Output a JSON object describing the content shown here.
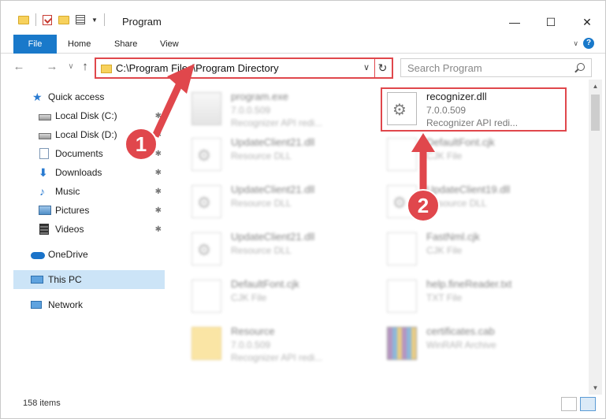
{
  "window": {
    "title": "Program",
    "controls": {
      "minimize": "—",
      "maximize": "☐",
      "close": "✕"
    }
  },
  "ribbon": {
    "tabs": [
      {
        "label": "File"
      },
      {
        "label": "Home"
      },
      {
        "label": "Share"
      },
      {
        "label": "View"
      }
    ],
    "help": "?",
    "expand": "∨"
  },
  "navigation": {
    "back": "←",
    "forward": "→",
    "recent": "∨",
    "up": "↑",
    "address": "C:\\Program Files\\Program Directory",
    "address_chevron": "∨",
    "refresh": "↻",
    "search_placeholder": "Search Program"
  },
  "sidebar": {
    "items": [
      {
        "label": "Quick access",
        "icon": "star-icon",
        "pinned": false
      },
      {
        "label": "Local Disk (C:)",
        "icon": "drive-icon",
        "pinned": true
      },
      {
        "label": "Local Disk (D:)",
        "icon": "drive-icon",
        "pinned": true
      },
      {
        "label": "Documents",
        "icon": "documents-icon",
        "pinned": true
      },
      {
        "label": "Downloads",
        "icon": "download-icon",
        "pinned": true
      },
      {
        "label": "Music",
        "icon": "music-icon",
        "pinned": true
      },
      {
        "label": "Pictures",
        "icon": "pictures-icon",
        "pinned": true
      },
      {
        "label": "Videos",
        "icon": "videos-icon",
        "pinned": true
      },
      {
        "label": "OneDrive",
        "icon": "cloud-icon",
        "pinned": false
      },
      {
        "label": "This PC",
        "icon": "computer-icon",
        "pinned": false,
        "selected": true
      },
      {
        "label": "Network",
        "icon": "network-icon",
        "pinned": false
      }
    ],
    "pin_glyph": "📌"
  },
  "files": [
    {
      "name": "program.exe",
      "meta1": "7.0.0.509",
      "meta2": "Recognizer API redi...",
      "icon": "exe-icon",
      "blurred": true
    },
    {
      "name": "recognizer.dll",
      "meta1": "7.0.0.509",
      "meta2": "Recognizer API redi...",
      "icon": "dll-icon",
      "blurred": false,
      "highlighted": true
    },
    {
      "name": "UpdateClient21.dll",
      "meta1": "Resource DLL",
      "meta2": "",
      "icon": "dll-icon",
      "blurred": true
    },
    {
      "name": "DefaultFont.cjk",
      "meta1": "CJK File",
      "meta2": "",
      "icon": "document-icon",
      "blurred": true
    },
    {
      "name": "UpdateClient21.dll",
      "meta1": "Resource DLL",
      "meta2": "",
      "icon": "dll-icon",
      "blurred": true
    },
    {
      "name": "UpdateClient19.dll",
      "meta1": "Resource DLL",
      "meta2": "",
      "icon": "dll-icon",
      "blurred": true
    },
    {
      "name": "UpdateClient21.dll",
      "meta1": "Resource DLL",
      "meta2": "",
      "icon": "dll-icon",
      "blurred": true
    },
    {
      "name": "FastNml.cjk",
      "meta1": "CJK File",
      "meta2": "",
      "icon": "document-icon",
      "blurred": true
    },
    {
      "name": "DefaultFont.cjk",
      "meta1": "CJK File",
      "meta2": "",
      "icon": "document-icon",
      "blurred": true
    },
    {
      "name": "help.fineReader.txt",
      "meta1": "TXT File",
      "meta2": "",
      "icon": "document-icon",
      "blurred": true
    },
    {
      "name": "Resource",
      "meta1": "7.0.0.509",
      "meta2": "Recognizer API redi...",
      "icon": "folder-icon",
      "blurred": true
    },
    {
      "name": "certificates.cab",
      "meta1": "WinRAR Archive",
      "meta2": "",
      "icon": "archive-icon",
      "blurred": true
    }
  ],
  "status": {
    "item_count": "158 items"
  },
  "annotations": {
    "step1": "1",
    "step2": "2",
    "color": "#e0474c"
  }
}
